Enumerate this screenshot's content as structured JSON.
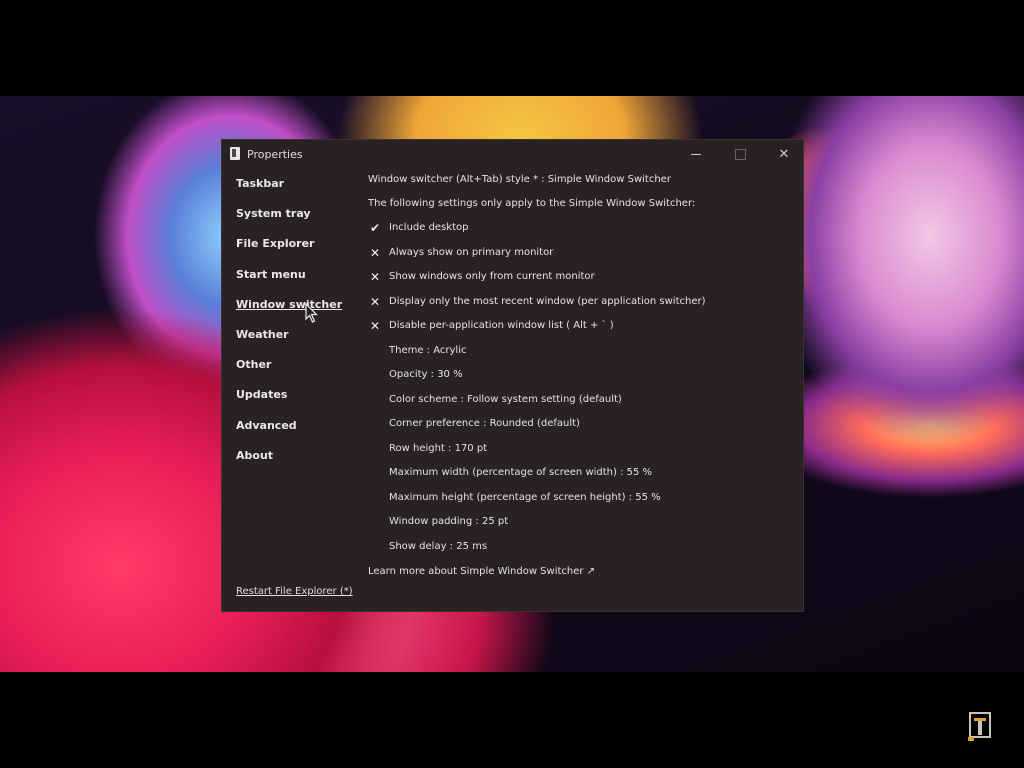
{
  "window": {
    "title": "Properties",
    "minimize_glyph": "—",
    "close_glyph": "✕"
  },
  "sidebar": {
    "items": [
      {
        "label": "Taskbar"
      },
      {
        "label": "System tray"
      },
      {
        "label": "File Explorer"
      },
      {
        "label": "Start menu"
      },
      {
        "label": "Window switcher",
        "active": true
      },
      {
        "label": "Weather"
      },
      {
        "label": "Other"
      },
      {
        "label": "Updates"
      },
      {
        "label": "Advanced"
      },
      {
        "label": "About"
      }
    ],
    "restart_link": "Restart File Explorer (*)"
  },
  "content": {
    "style_line": "Window switcher (Alt+Tab) style * : Simple Window Switcher",
    "settings_note": "The following settings only apply to the Simple Window Switcher:",
    "options": [
      {
        "icon": "check-icon",
        "glyph": "✔",
        "label": "Include desktop"
      },
      {
        "icon": "x-icon",
        "glyph": "✕",
        "label": "Always show on primary monitor"
      },
      {
        "icon": "x-icon",
        "glyph": "✕",
        "label": "Show windows only from current monitor"
      },
      {
        "icon": "x-icon",
        "glyph": "✕",
        "label": "Display only the most recent window (per application switcher)"
      },
      {
        "icon": "x-icon",
        "glyph": "✕",
        "label": "Disable per-application window list ( Alt + ` )"
      }
    ],
    "values": [
      "Theme : Acrylic",
      "Opacity : 30 %",
      "Color scheme : Follow system setting (default)",
      "Corner preference : Rounded (default)",
      "Row height : 170 pt",
      "Maximum width (percentage of screen width) : 55 %",
      "Maximum height (percentage of screen height) : 55 %",
      "Window padding : 25 pt",
      "Show delay : 25 ms"
    ],
    "learn_more": "Learn more about Simple Window Switcher ↗"
  }
}
